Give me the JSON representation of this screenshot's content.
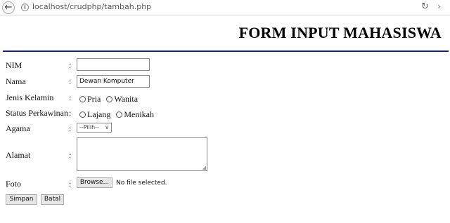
{
  "browser": {
    "url": "localhost/crudphp/tambah.php"
  },
  "page": {
    "title": "FORM INPUT MAHASISWA"
  },
  "form": {
    "colon": ":",
    "nim": {
      "label": "NIM",
      "value": ""
    },
    "nama": {
      "label": "Nama",
      "value": "Dewan Komputer"
    },
    "jenis_kelamin": {
      "label": "Jenis Kelamin",
      "options": [
        "Pria",
        "Wanita"
      ]
    },
    "status": {
      "label": "Status Perkawinan",
      "options": [
        "Lajang",
        "Menikah"
      ]
    },
    "agama": {
      "label": "Agama",
      "selected": "--Pilih--"
    },
    "alamat": {
      "label": "Alamat",
      "value": ""
    },
    "foto": {
      "label": "Foto",
      "browse_label": "Browse...",
      "file_status": "No file selected."
    },
    "buttons": {
      "save": "Simpan",
      "cancel": "Batal"
    }
  }
}
